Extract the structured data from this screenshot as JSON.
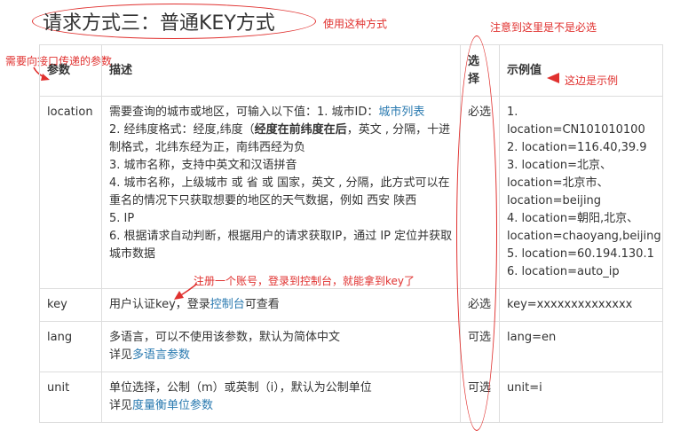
{
  "title": "请求方式三：普通KEY方式",
  "notes": {
    "use_this": "使用这种方式",
    "required_notice": "注意到这里是不是必选",
    "params_hint": "需要向接口传递的参数",
    "example_hint": "这边是示例",
    "key_hint": "注册一个账号，登录到控制台，就能拿到key了"
  },
  "table": {
    "headers": {
      "param": "参数",
      "desc": "描述",
      "choice_1": "选",
      "choice_2": "择",
      "example": "示例值"
    },
    "rows": [
      {
        "param": "location",
        "desc": {
          "l1_pre": "需要查询的城市或地区，可输入以下值：1. 城市ID：",
          "l1_link": "城市列表",
          "l2_pre": "2. 经纬度格式：经度,纬度（",
          "l2_bold": "经度在前纬度在后",
          "l2_post": "，英文 , 分隔，十进制格式，北纬东经为正，南纬西经为负",
          "l3": "3. 城市名称，支持中英文和汉语拼音",
          "l4": "4. 城市名称，上级城市 或 省 或 国家，英文 , 分隔，此方式可以在重名的情况下只获取想要的地区的天气数据，例如 西安 陕西",
          "l5": "5. IP",
          "l6": "6. 根据请求自动判断，根据用户的请求获取IP，通过 IP 定位并获取城市数据"
        },
        "choice": "必选",
        "examples": [
          "1. location=CN101010100",
          "2. location=116.40,39.9",
          "3. location=北京、",
          "location=北京市、",
          "location=beijing",
          "4. location=朝阳,北京、",
          "location=chaoyang,beijing",
          "5. location=60.194.130.1",
          "6. location=auto_ip"
        ]
      },
      {
        "param": "key",
        "desc_pre": "用户认证key，登录",
        "desc_link": "控制台",
        "desc_post": "可查看",
        "choice": "必选",
        "example": "key=xxxxxxxxxxxxxx"
      },
      {
        "param": "lang",
        "desc_l1": "多语言，可以不使用该参数，默认为简体中文",
        "desc_l2_pre": "详见",
        "desc_l2_link": "多语言参数",
        "choice": "可选",
        "example": "lang=en"
      },
      {
        "param": "unit",
        "desc_l1": "单位选择，公制（m）或英制（i），默认为公制单位",
        "desc_l2_pre": "详见",
        "desc_l2_link": "度量衡单位参数",
        "choice": "可选",
        "example": "unit=i"
      }
    ]
  },
  "colors": {
    "annotation": "#e0312f",
    "link": "#2a7ab0",
    "border": "#dddddd"
  }
}
